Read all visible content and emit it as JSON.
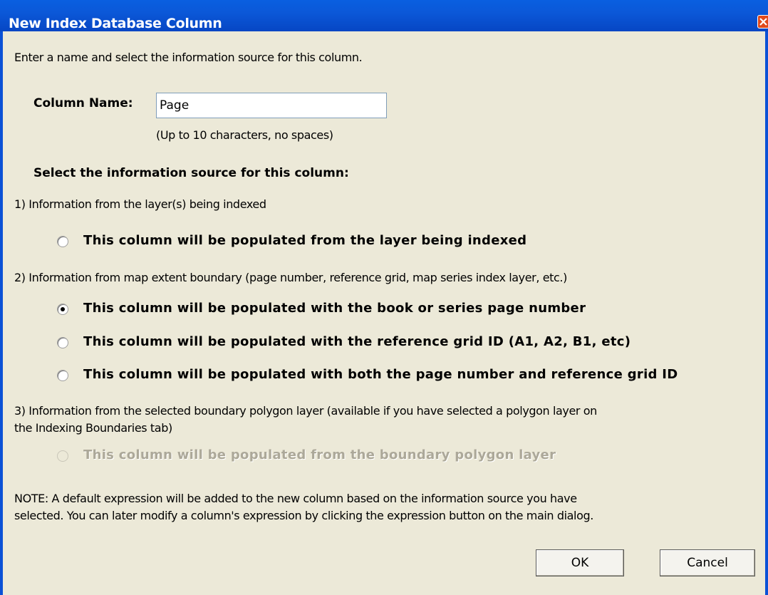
{
  "window": {
    "title": "New Index Database Column"
  },
  "intro": "Enter a name and select the information source for this column.",
  "column_name": {
    "label": "Column Name:",
    "value": "Page",
    "hint": "(Up to 10 characters, no spaces)"
  },
  "source": {
    "heading": "Select the information source for this column:",
    "section1": "1) Information from the layer(s) being indexed",
    "option_layer": "This column will be populated from the layer being indexed",
    "section2": "2) Information from map extent boundary (page number, reference grid, map series index layer, etc.)",
    "option_page": "This column will be populated with the book or series page number",
    "option_grid": "This column will be populated with the reference grid ID (A1, A2, B1, etc)",
    "option_both": "This column will be populated with both the page number and reference grid ID",
    "section3_line1": "3) Information from the selected boundary polygon layer (available if you have selected a polygon layer on",
    "section3_line2": "the Indexing Boundaries tab)",
    "option_polygon": "This column will be populated from the boundary polygon layer",
    "selected": "option_page"
  },
  "note": {
    "line1": "NOTE: A default expression will be added to the new column based on the information source you have",
    "line2": "selected.  You can later modify a column's expression by clicking the expression button on the main dialog."
  },
  "buttons": {
    "ok": "OK",
    "cancel": "Cancel"
  }
}
